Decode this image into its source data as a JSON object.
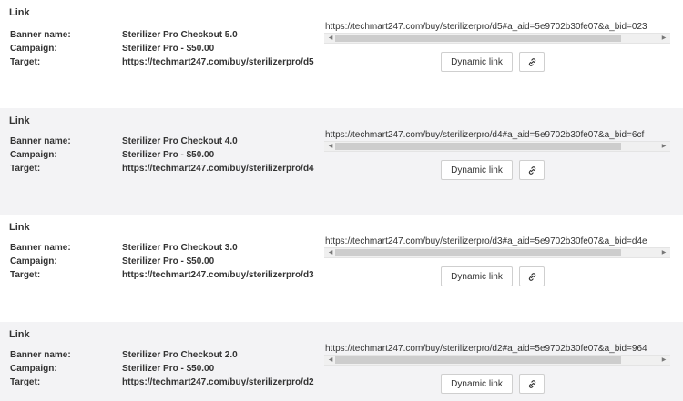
{
  "blocks": [
    {
      "heading": "Link",
      "banner_label": "Banner name:",
      "banner_value": "Sterilizer Pro Checkout 5.0",
      "campaign_label": "Campaign:",
      "campaign_value": "Sterilizer Pro - $50.00",
      "target_label": "Target:",
      "target_value": "https://techmart247.com/buy/sterilizerpro/d5",
      "url": "https://techmart247.com/buy/sterilizerpro/d5#a_aid=5e9702b30fe07&a_bid=023",
      "dynamic_label": "Dynamic link"
    },
    {
      "heading": "Link",
      "banner_label": "Banner name:",
      "banner_value": "Sterilizer Pro Checkout 4.0",
      "campaign_label": "Campaign:",
      "campaign_value": "Sterilizer Pro - $50.00",
      "target_label": "Target:",
      "target_value": "https://techmart247.com/buy/sterilizerpro/d4",
      "url": "https://techmart247.com/buy/sterilizerpro/d4#a_aid=5e9702b30fe07&a_bid=6cf",
      "dynamic_label": "Dynamic link"
    },
    {
      "heading": "Link",
      "banner_label": "Banner name:",
      "banner_value": "Sterilizer Pro Checkout 3.0",
      "campaign_label": "Campaign:",
      "campaign_value": "Sterilizer Pro - $50.00",
      "target_label": "Target:",
      "target_value": "https://techmart247.com/buy/sterilizerpro/d3",
      "url": "https://techmart247.com/buy/sterilizerpro/d3#a_aid=5e9702b30fe07&a_bid=d4e",
      "dynamic_label": "Dynamic link"
    },
    {
      "heading": "Link",
      "banner_label": "Banner name:",
      "banner_value": "Sterilizer Pro Checkout 2.0",
      "campaign_label": "Campaign:",
      "campaign_value": "Sterilizer Pro - $50.00",
      "target_label": "Target:",
      "target_value": "https://techmart247.com/buy/sterilizerpro/d2",
      "url": "https://techmart247.com/buy/sterilizerpro/d2#a_aid=5e9702b30fe07&a_bid=964",
      "dynamic_label": "Dynamic link"
    }
  ],
  "icons": {
    "copy_link": "link-icon",
    "scroll_left": "arrow-left-icon",
    "scroll_right": "arrow-right-icon"
  },
  "colors": {
    "alt_background": "#f3f3f5",
    "scroll_thumb": "#cdcdcd"
  }
}
